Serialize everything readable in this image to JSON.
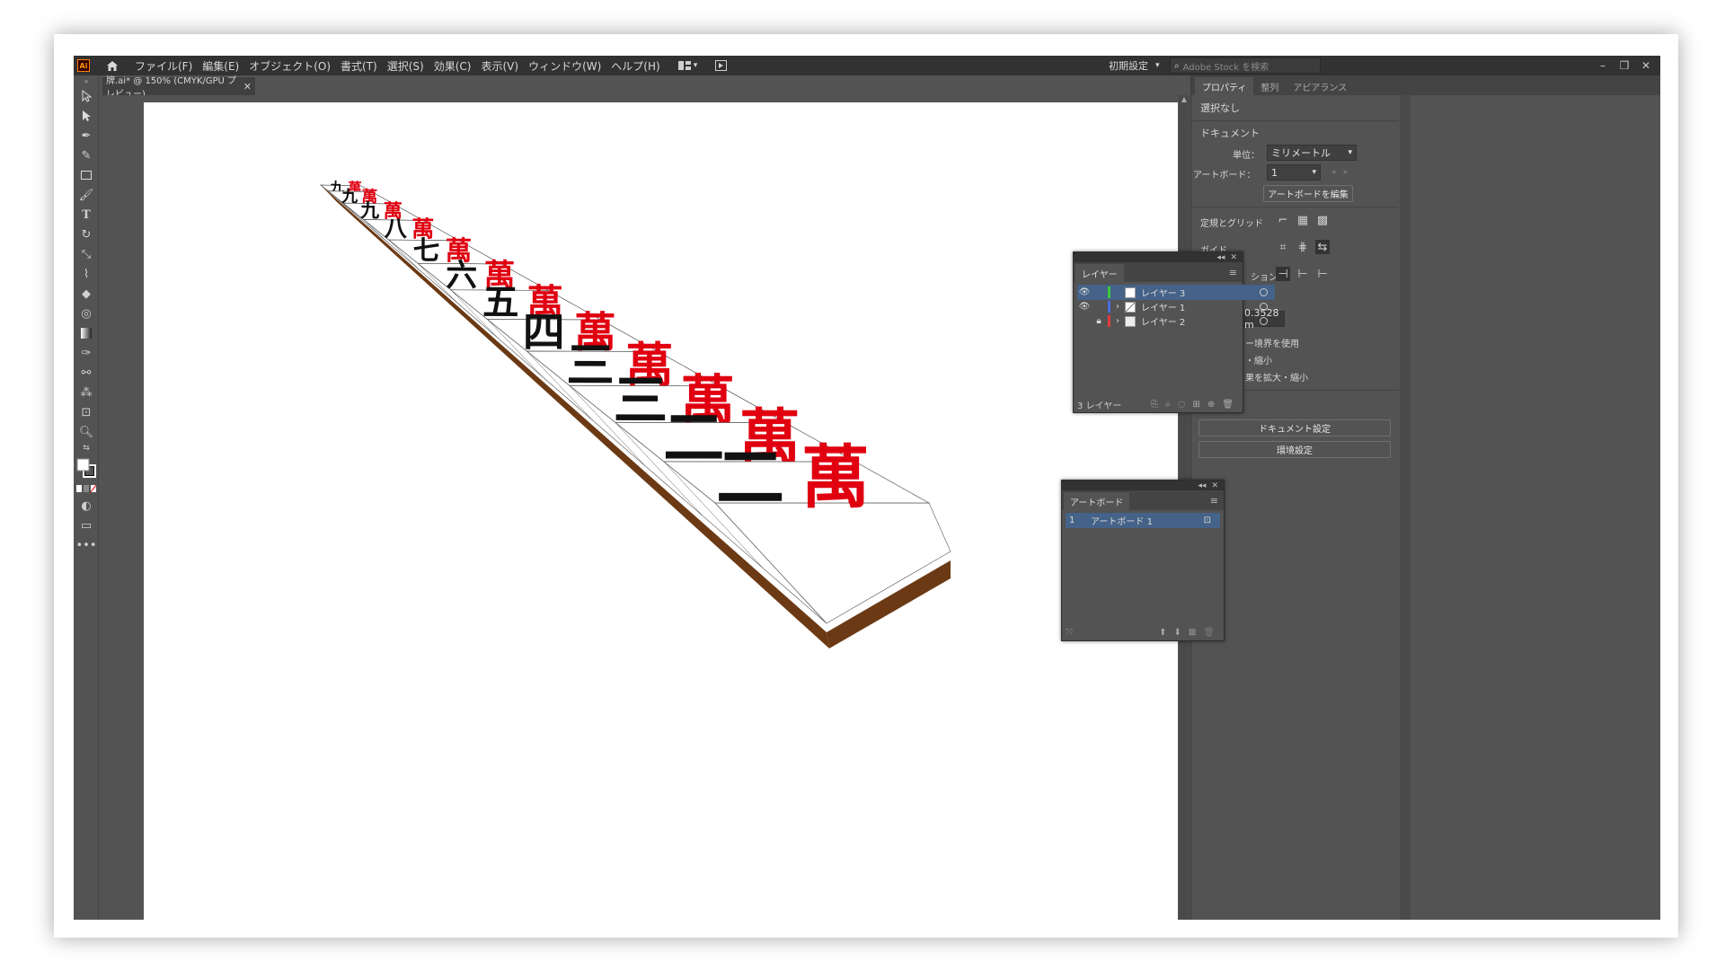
{
  "app": {
    "logo": "Ai",
    "menus": [
      "ファイル(F)",
      "編集(E)",
      "オブジェクト(O)",
      "書式(T)",
      "選択(S)",
      "効果(C)",
      "表示(V)",
      "ウィンドウ(W)",
      "ヘルプ(H)"
    ],
    "workspace": "初期設定",
    "search_placeholder": "Adobe Stock を検索"
  },
  "document": {
    "tab_title": "牌.ai* @ 150% (CMYK/GPU プレビュー)"
  },
  "artwork": {
    "tile_numerals": [
      "二",
      "二",
      "三",
      "三",
      "四",
      "五",
      "六",
      "七",
      "八",
      "九",
      "九",
      "九"
    ],
    "tile_suit": "萬",
    "colors": {
      "tile_face": "#ffffff",
      "tile_edge": "#555555",
      "tile_base": "#6b3a14",
      "numeral": "#111111",
      "suit": "#e00010"
    }
  },
  "properties_panel": {
    "tabs": [
      "プロパティ",
      "整列",
      "アピアランス"
    ],
    "active_tab": "プロパティ",
    "no_selection": "選択なし",
    "document_heading": "ドキュメント",
    "units_label": "単位：",
    "units_value": "ミリメートル",
    "artboard_label": "アートボード：",
    "artboard_value": "1",
    "edit_artboard_button": "アートボードを編集",
    "rulers_grid_label": "定規とグリッド",
    "guides_label": "ガイド",
    "snap_label": "ション",
    "keyline_value": "0.3528 m",
    "option1": "ー境界を使用",
    "option2": "・縮小",
    "option3": "果を拡大・縮小",
    "doc_settings_button": "ドキュメント設定",
    "preferences_button": "環境設定"
  },
  "layers_panel": {
    "tab": "レイヤー",
    "layers": [
      {
        "name": "レイヤー 3",
        "visible": true,
        "locked": false,
        "color": "#3cc83c",
        "selected": true
      },
      {
        "name": "レイヤー 1",
        "visible": true,
        "locked": false,
        "color": "#4a6fe0",
        "selected": false
      },
      {
        "name": "レイヤー 2",
        "visible": false,
        "locked": true,
        "color": "#e03c3c",
        "selected": false
      }
    ],
    "count": "3 レイヤー"
  },
  "artboards_panel": {
    "tab": "アートボード",
    "items": [
      {
        "index": "1",
        "name": "アートボード 1"
      }
    ]
  }
}
